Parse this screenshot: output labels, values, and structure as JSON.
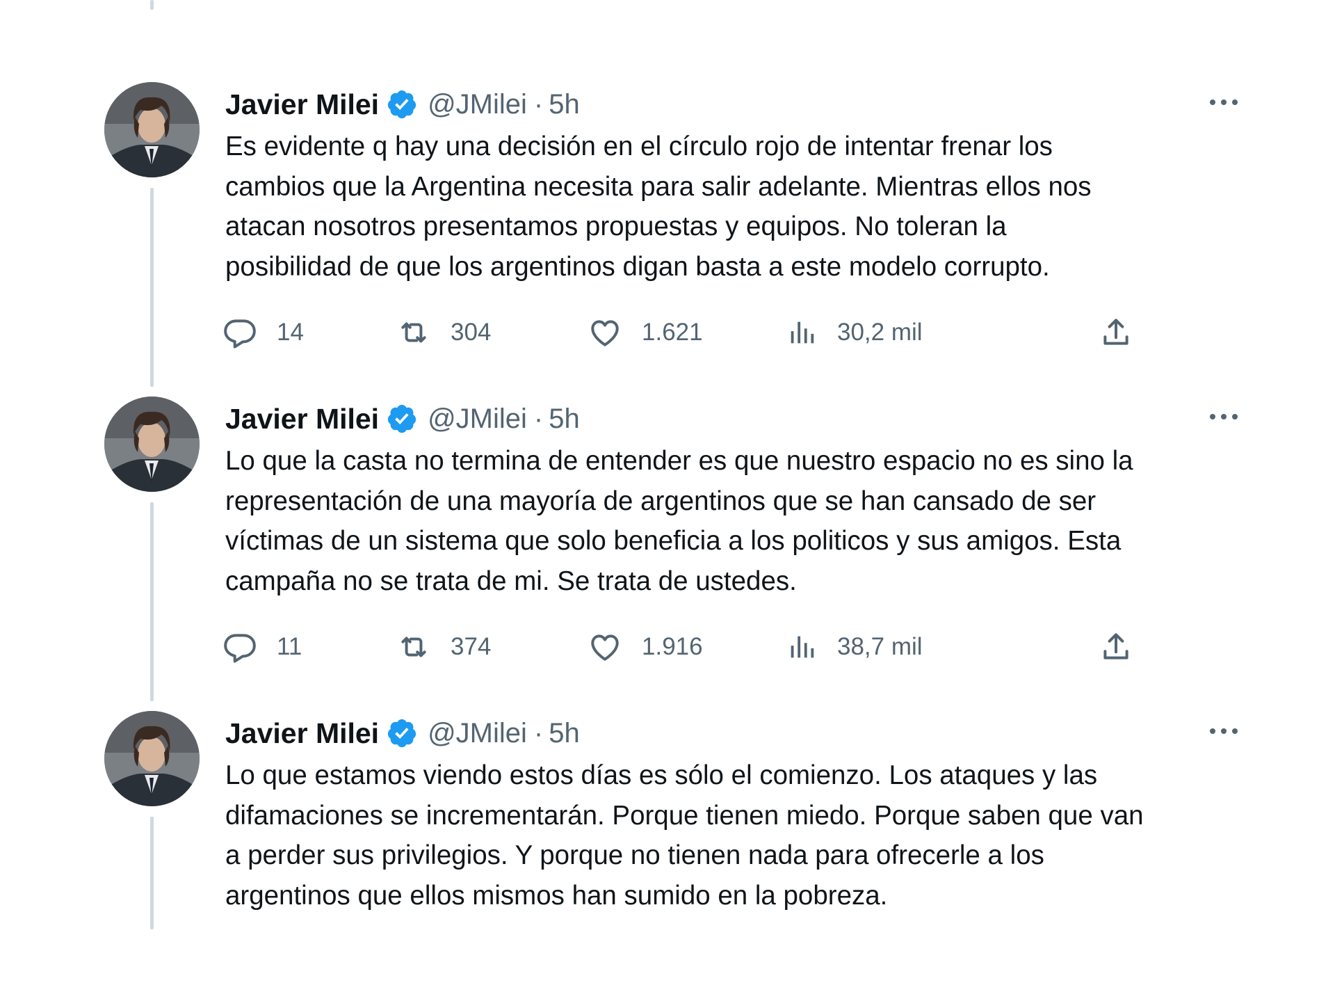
{
  "colors": {
    "text": "#0f1419",
    "secondary": "#536471",
    "verified": "#1d9bf0",
    "thread_line": "#cfd9de"
  },
  "tweets": [
    {
      "author_name": "Javier Milei",
      "handle": "@JMilei",
      "separator": "·",
      "time": "5h",
      "text": "Es evidente q hay una decisión en el círculo rojo de intentar frenar los\ncambios que la Argentina necesita para salir adelante. Mientras ellos nos\natacan nosotros presentamos propuestas y equipos. No toleran la\nposibilidad de que los argentinos digan basta a este modelo corrupto.",
      "replies": "14",
      "retweets": "304",
      "likes": "1.621",
      "views": "30,2 mil"
    },
    {
      "author_name": "Javier Milei",
      "handle": "@JMilei",
      "separator": "·",
      "time": "5h",
      "text": "Lo que la casta no termina de entender es que nuestro espacio no es sino la\nrepresentación de una mayoría de argentinos que se han cansado de ser\nvíctimas de un sistema que solo beneficia a los politicos y sus amigos. Esta\ncampaña no se trata de mi. Se trata de ustedes.",
      "replies": "11",
      "retweets": "374",
      "likes": "1.916",
      "views": "38,7 mil"
    },
    {
      "author_name": "Javier Milei",
      "handle": "@JMilei",
      "separator": "·",
      "time": "5h",
      "text": "Lo que estamos viendo estos días es sólo el comienzo. Los ataques y las\ndifamaciones se incrementarán. Porque tienen miedo. Porque saben que van\na perder sus privilegios. Y porque no tienen nada para ofrecerle a los\nargentinos que ellos mismos han sumido en la pobreza."
    }
  ],
  "icons": {
    "reply": "reply-icon",
    "retweet": "retweet-icon",
    "like": "like-icon",
    "views": "views-icon",
    "share": "share-icon",
    "more": "more-icon",
    "verified": "verified-badge-icon"
  }
}
